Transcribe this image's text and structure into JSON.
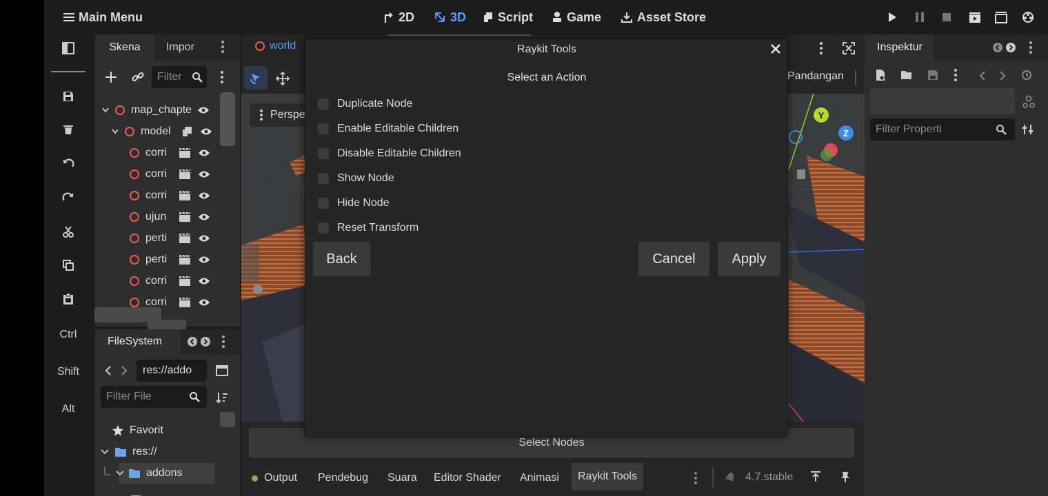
{
  "topbar": {
    "main_menu": "Main Menu",
    "btn_2d": "2D",
    "btn_3d": "3D",
    "btn_script": "Script",
    "btn_game": "Game",
    "btn_asset": "Asset Store"
  },
  "leftbar": {
    "ctrl": "Ctrl",
    "shift": "Shift",
    "alt": "Alt"
  },
  "scene_panel": {
    "tab_scene": "Skena",
    "tab_import": "Impor",
    "filter_placeholder": "Filter",
    "nodes": [
      {
        "label": "map_chapte"
      },
      {
        "label": "model"
      },
      {
        "label": "corri"
      },
      {
        "label": "corri"
      },
      {
        "label": "corri"
      },
      {
        "label": "ujun"
      },
      {
        "label": "perti"
      },
      {
        "label": "perti"
      },
      {
        "label": "corri"
      },
      {
        "label": "corri"
      }
    ]
  },
  "filesystem": {
    "title": "FileSystem",
    "path": "res://addo",
    "filter_placeholder": "Filter File",
    "items": [
      {
        "label": "Favorit"
      },
      {
        "label": "res://"
      },
      {
        "label": "addons"
      }
    ]
  },
  "viewport": {
    "scene_tab": "world",
    "perspective": "Perspe",
    "view_menu": "Pandangan"
  },
  "dialog": {
    "title": "Raykit Tools",
    "subtitle": "Select an Action",
    "options": [
      {
        "label": "Duplicate Node",
        "checked": false
      },
      {
        "label": "Enable Editable Children",
        "checked": false
      },
      {
        "label": "Disable Editable Children",
        "checked": false
      },
      {
        "label": "Show Node",
        "checked": false
      },
      {
        "label": "Hide Node",
        "checked": false
      },
      {
        "label": "Reset Transform",
        "checked": false
      }
    ],
    "back": "Back",
    "cancel": "Cancel",
    "apply": "Apply"
  },
  "select_nodes": "Select Nodes",
  "bottom_tabs": [
    {
      "label": "Output"
    },
    {
      "label": "Pendebug"
    },
    {
      "label": "Suara"
    },
    {
      "label": "Editor Shader"
    },
    {
      "label": "Animasi"
    },
    {
      "label": "Raykit Tools"
    }
  ],
  "version": "4.7.stable",
  "inspector": {
    "title": "Inspektur",
    "filter_placeholder": "Filter Properti"
  },
  "gizmo": {
    "y": "Y",
    "z": "Z"
  },
  "colors": {
    "accent": "#5a9cf0",
    "node_ring": "#e85b5b"
  }
}
